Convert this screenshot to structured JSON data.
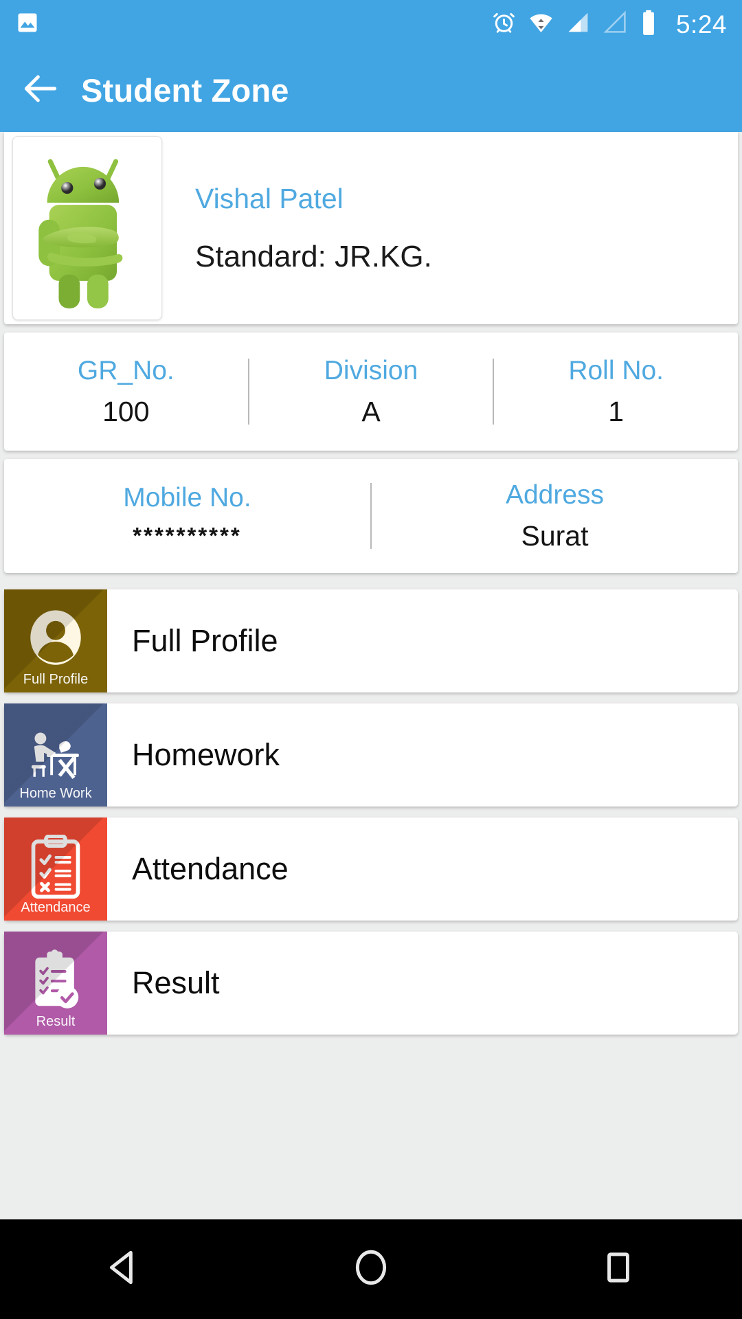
{
  "statusbar": {
    "time": "5:24",
    "icons": [
      "image-icon",
      "alarm-icon",
      "wifi-icon",
      "signal-icon",
      "signal-secondary-icon",
      "battery-icon"
    ]
  },
  "appbar": {
    "title": "Student Zone",
    "back_icon": "arrow-left-icon"
  },
  "profile": {
    "avatar_icon": "android-mascot-avatar",
    "name": "Vishal Patel",
    "standard": "Standard: JR.KG."
  },
  "info_row_1": [
    {
      "label": "GR_No.",
      "value": "100"
    },
    {
      "label": "Division",
      "value": "A"
    },
    {
      "label": "Roll No.",
      "value": "1"
    }
  ],
  "info_row_2": [
    {
      "label": "Mobile No.",
      "value": "**********"
    },
    {
      "label": "Address",
      "value": "Surat"
    }
  ],
  "menu": [
    {
      "label": "Full Profile",
      "tile_caption": "Full Profile",
      "color": "#7c6307",
      "icon": "person-avatar-icon"
    },
    {
      "label": "Homework",
      "tile_caption": "Home Work",
      "color": "#4e6290",
      "icon": "student-desk-icon"
    },
    {
      "label": "Attendance",
      "tile_caption": "Attendance",
      "color": "#f04a32",
      "icon": "clipboard-check-cross-icon"
    },
    {
      "label": "Result",
      "tile_caption": "Result",
      "color": "#b05aa8",
      "icon": "clipboard-approved-icon"
    }
  ],
  "navbar": {
    "back_label": "back-button",
    "home_label": "home-button",
    "recents_label": "recents-button"
  },
  "colors": {
    "accent": "#41a5e4",
    "link": "#4fa9e0",
    "text": "#111111"
  }
}
